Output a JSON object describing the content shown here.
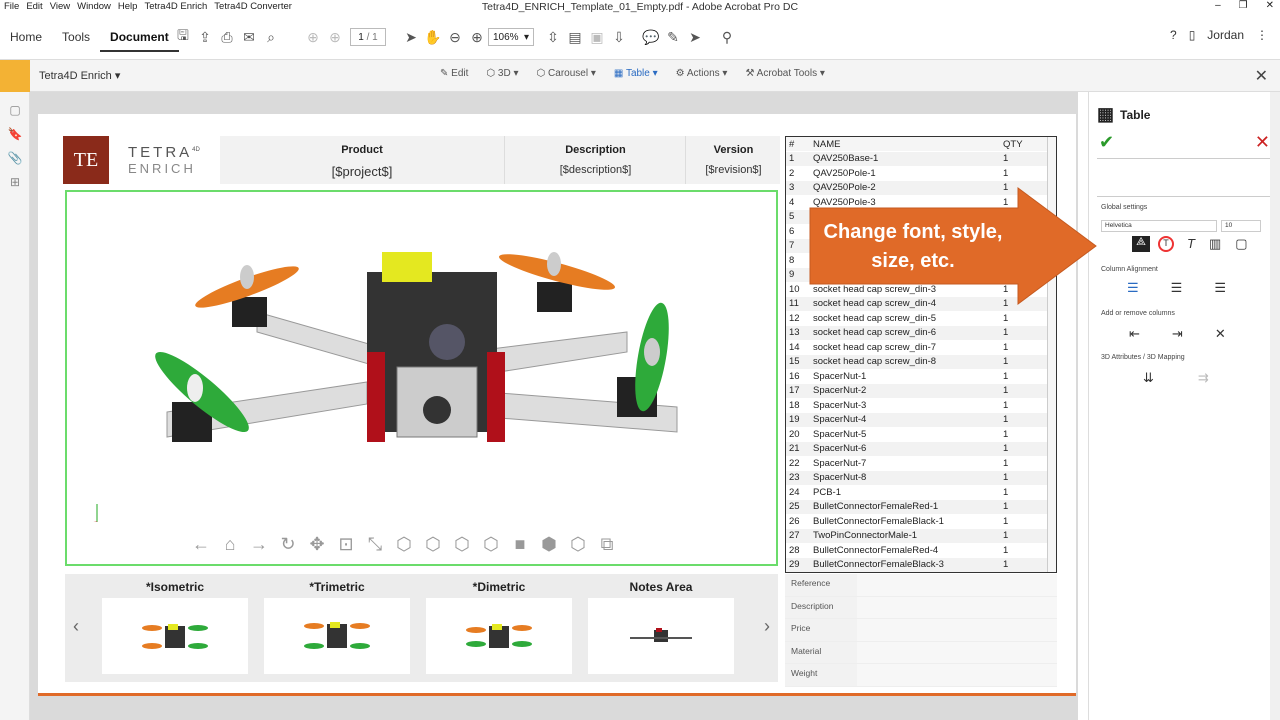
{
  "window": {
    "title": "Tetra4D_ENRICH_Template_01_Empty.pdf - Adobe Acrobat Pro DC",
    "menu": [
      "File",
      "Edit",
      "View",
      "Window",
      "Help",
      "Tetra4D Enrich",
      "Tetra4D Converter"
    ]
  },
  "toolbar": {
    "home": "Home",
    "tools": "Tools",
    "document": "Document",
    "page_current": "1",
    "page_total": "/ 1",
    "zoom": "106%",
    "user": "Jordan"
  },
  "subbar": {
    "plugin": "Tetra4D Enrich",
    "items": [
      "Edit",
      "3D",
      "Carousel",
      "Table",
      "Actions",
      "Acrobat Tools"
    ]
  },
  "brand": {
    "logo": "TE",
    "line1": "TETRA",
    "sup": "4D",
    "line2": "ENRICH"
  },
  "header_table": {
    "product_label": "Product",
    "product_value": "[$project$]",
    "description_label": "Description",
    "description_value": "[$description$]",
    "version_label": "Version",
    "version_value": "[$revision$]"
  },
  "views": [
    {
      "label": "*Isometric"
    },
    {
      "label": "*Trimetric"
    },
    {
      "label": "*Dimetric"
    },
    {
      "label": "Notes Area"
    }
  ],
  "parts_table": {
    "headers": [
      "#",
      "NAME",
      "QTY"
    ],
    "rows": [
      [
        "1",
        "QAV250Base-1",
        "1"
      ],
      [
        "2",
        "QAV250Pole-1",
        "1"
      ],
      [
        "3",
        "QAV250Pole-2",
        "1"
      ],
      [
        "4",
        "QAV250Pole-3",
        "1"
      ],
      [
        "5",
        "",
        "1"
      ],
      [
        "6",
        "",
        "1"
      ],
      [
        "7",
        "",
        "1"
      ],
      [
        "8",
        "",
        "1"
      ],
      [
        "9",
        "",
        "1"
      ],
      [
        "10",
        "socket head cap screw_din-3",
        "1"
      ],
      [
        "11",
        "socket head cap screw_din-4",
        "1"
      ],
      [
        "12",
        "socket head cap screw_din-5",
        "1"
      ],
      [
        "13",
        "socket head cap screw_din-6",
        "1"
      ],
      [
        "14",
        "socket head cap screw_din-7",
        "1"
      ],
      [
        "15",
        "socket head cap screw_din-8",
        "1"
      ],
      [
        "16",
        "SpacerNut-1",
        "1"
      ],
      [
        "17",
        "SpacerNut-2",
        "1"
      ],
      [
        "18",
        "SpacerNut-3",
        "1"
      ],
      [
        "19",
        "SpacerNut-4",
        "1"
      ],
      [
        "20",
        "SpacerNut-5",
        "1"
      ],
      [
        "21",
        "SpacerNut-6",
        "1"
      ],
      [
        "22",
        "SpacerNut-7",
        "1"
      ],
      [
        "23",
        "SpacerNut-8",
        "1"
      ],
      [
        "24",
        "PCB-1",
        "1"
      ],
      [
        "25",
        "BulletConnectorFemaleRed-1",
        "1"
      ],
      [
        "26",
        "BulletConnectorFemaleBlack-1",
        "1"
      ],
      [
        "27",
        "TwoPinConnectorMale-1",
        "1"
      ],
      [
        "28",
        "BulletConnectorFemaleRed-4",
        "1"
      ],
      [
        "29",
        "BulletConnectorFemaleBlack-3",
        "1"
      ]
    ]
  },
  "properties": [
    "Reference",
    "Description",
    "Price",
    "Material",
    "Weight"
  ],
  "callout": {
    "line1": "Change font, style,",
    "line2": "size, etc."
  },
  "right_panel": {
    "title": "Table",
    "global_settings": "Global settings",
    "font": "Helvetica",
    "size": "10",
    "column_alignment": "Column Alignment",
    "add_remove": "Add or remove columns",
    "attributes": "3D Attributes / 3D Mapping"
  },
  "colors": {
    "accent_orange": "#e06a28",
    "frame_green": "#6bdc6b",
    "logo_red": "#8a2a1a"
  }
}
